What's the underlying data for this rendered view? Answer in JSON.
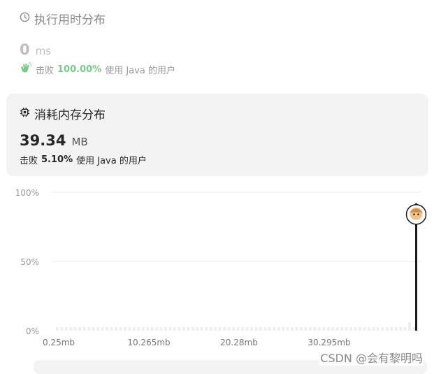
{
  "runtime": {
    "title": "执行用时分布",
    "value": "0",
    "unit": "ms",
    "beat_prefix": "击败",
    "beat_percent": "100.00%",
    "beat_suffix": "使用 Java 的用户"
  },
  "memory": {
    "title": "消耗内存分布",
    "value": "39.34",
    "unit": "MB",
    "beat_prefix": "击败",
    "beat_percent": "5.10%",
    "beat_suffix": "使用 Java 的用户"
  },
  "chart_data": {
    "type": "bar",
    "title": "",
    "xlabel": "",
    "ylabel": "",
    "x_ticks": [
      "0.25mb",
      "10.265mb",
      "20.28mb",
      "30.295mb"
    ],
    "y_ticks": [
      "100%",
      "50%",
      "0%"
    ],
    "ylim": [
      0,
      100
    ],
    "grid": true,
    "bar_count": 80,
    "values_percent": [
      0.3,
      0.3,
      0.3,
      0.3,
      0.3,
      0.3,
      0.3,
      0.3,
      0.3,
      0.3,
      0.3,
      0.3,
      0.3,
      0.3,
      0.3,
      0.3,
      0.3,
      0.3,
      0.3,
      0.3,
      0.3,
      0.3,
      0.3,
      0.3,
      0.3,
      0.3,
      0.3,
      0.3,
      0.3,
      0.3,
      0.3,
      0.3,
      0.3,
      0.3,
      0.3,
      0.3,
      0.3,
      0.3,
      0.3,
      0.3,
      0.3,
      0.3,
      0.3,
      0.3,
      0.3,
      0.3,
      0.3,
      0.3,
      0.3,
      0.3,
      0.3,
      0.3,
      0.3,
      0.3,
      0.3,
      0.3,
      0.3,
      0.3,
      0.3,
      0.3,
      0.3,
      0.3,
      0.3,
      0.3,
      0.3,
      0.3,
      0.3,
      0.3,
      0.3,
      0.3,
      0.3,
      0.3,
      0.3,
      0.3,
      0.3,
      0.3,
      0.3,
      0.3,
      1.0,
      0.3
    ],
    "highlight": {
      "label": "you",
      "x_index": 79,
      "value_percent": 85
    },
    "colors": {
      "bar": "#eeeeee",
      "grid": "#ebebeb",
      "highlight_line": "#1a1a1a"
    }
  },
  "watermark": "CSDN @会有黎明吗"
}
